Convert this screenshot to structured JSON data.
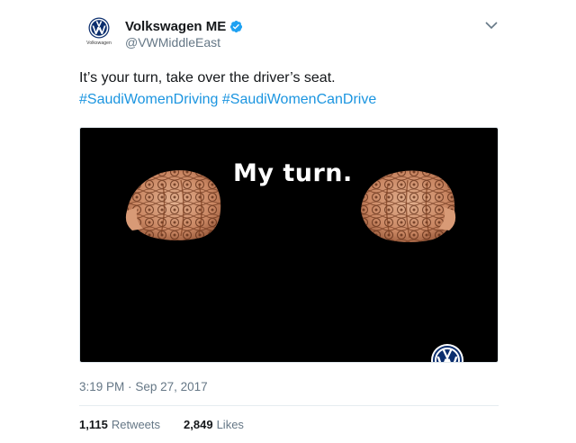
{
  "author": {
    "display_name": "Volkswagen ME",
    "handle": "@VWMiddleEast",
    "avatar_caption": "Volkswagen",
    "verified": true
  },
  "tweet": {
    "text": "It’s your turn, take over the driver’s seat.",
    "hashtags": [
      "#SaudiWomenDriving",
      "#SaudiWomenCanDrive"
    ]
  },
  "media": {
    "headline": "My turn.",
    "background_color": "#000000"
  },
  "meta": {
    "time": "3:19 PM",
    "separator": "·",
    "date": "Sep 27, 2017"
  },
  "stats": {
    "retweets_count": "1,115",
    "retweets_label": "Retweets",
    "likes_count": "2,849",
    "likes_label": "Likes"
  },
  "colors": {
    "link": "#1b95e0",
    "secondary_text": "#657786",
    "verified_badge": "#1da1f2",
    "vw_blue": "#0b2e6e"
  },
  "icons": [
    "vw-logo-icon",
    "verified-badge-icon",
    "chevron-down-icon",
    "henna-fist-icon"
  ]
}
